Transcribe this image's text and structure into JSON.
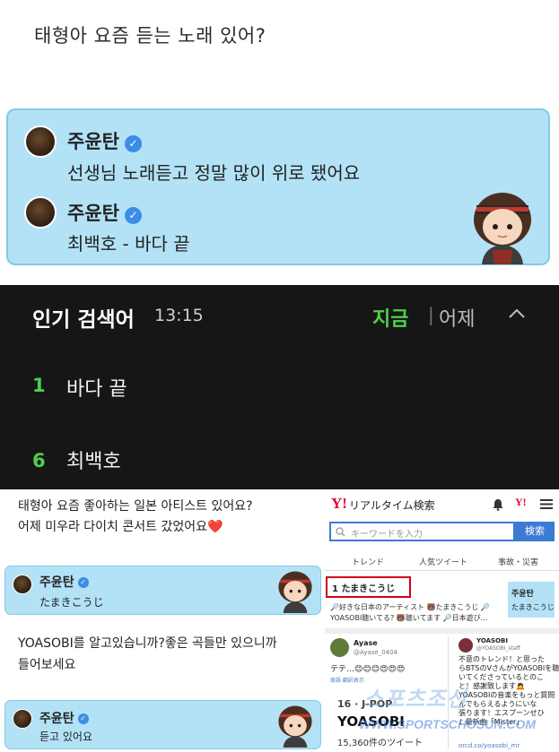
{
  "question_top": "태형아 요즘 듣는 노래 있어?",
  "reply_card": {
    "messages": [
      {
        "username": "주윤탄",
        "text": "선생님 노래듣고 정말 많이 위로 됐어요"
      },
      {
        "username": "주윤탄",
        "text": "최백호 - 바다 끝"
      }
    ]
  },
  "trending": {
    "title": "인기 검색어",
    "time": "13:15",
    "tab_now": "지금",
    "separator": "|",
    "tab_yesterday": "어제",
    "items": [
      {
        "rank": "1",
        "word": "바다 끝"
      },
      {
        "rank": "6",
        "word": "최백호"
      }
    ]
  },
  "lower_left": {
    "question": "태형아 요즘 좋아하는 일본 아티스트 있어요?",
    "question_line2": "어제 미우라 다이치 콘서트 갔었어요❤️",
    "card1": {
      "username": "주윤탄",
      "text": "たまきこうじ"
    },
    "question2_line1": "YOASOBI를 알고있습니까?좋은 곡들만 있으니까",
    "question2_line2": "들어보세요",
    "card2": {
      "username": "주윤탄",
      "text": "듣고 있어요"
    }
  },
  "yahoo": {
    "logo": "Y!",
    "title": "リアルタイム検索",
    "logo_right": "Y!",
    "search_placeholder": "キーワードを入力",
    "search_button": "検索",
    "tabs": [
      "トレンド",
      "人気ツイート",
      "事故・災害"
    ],
    "top_item": "1 たまきこうじ",
    "snippet_line1": "🔎好きな日本のアーティスト 🐻たまきこうじ 🔎",
    "snippet_line2": "YOASOBI聴いてる? 🐻聴いてます 🔎日本遊び…",
    "right_thumb_name": "주윤탄",
    "right_thumb_text": "たまきこうじ",
    "ayase_name": "Ayase",
    "ayase_handle": "@Ayase_0404",
    "ayase_text": "テテ…😊😊😊😍😍😍",
    "ayase_sub": "原語 翻訳表示",
    "yoasobi_handle": "YOASOBI",
    "yoasobi_sub": "@YOASOBI_staff",
    "yoasobi_text1": "不意のトレンド！と思った",
    "yoasobi_text2": "らBTSのVさんがYOASOBIを聴",
    "yoasobi_text3": "いてくださっているとのこ",
    "yoasobi_text4": "と！感謝致します🙇",
    "yoasobi_text5": "YOASOBIの音楽をもっと質問",
    "yoasobi_text6": "んでもらえるようにいな",
    "yoasobi_text7": "張ります！エスプーンせひ",
    "yoasobi_song": "♪ 最新曲「Mister」",
    "yoasobi_link": "orcd.co/yoasobi_mr",
    "genre": "16 · J-POP",
    "big_label": "YOASOBI",
    "tweet_count": "15,360件のツイート"
  },
  "watermark": {
    "brand": "스포츠조선",
    "url": "WWW.SPORTSCHOSUN.COM"
  },
  "colors": {
    "card_bg": "#b3e2f7",
    "verified": "#3a8ee6",
    "trending_green": "#4fd14a",
    "yahoo_red": "#e60033",
    "yahoo_blue": "#3b7bd4"
  }
}
